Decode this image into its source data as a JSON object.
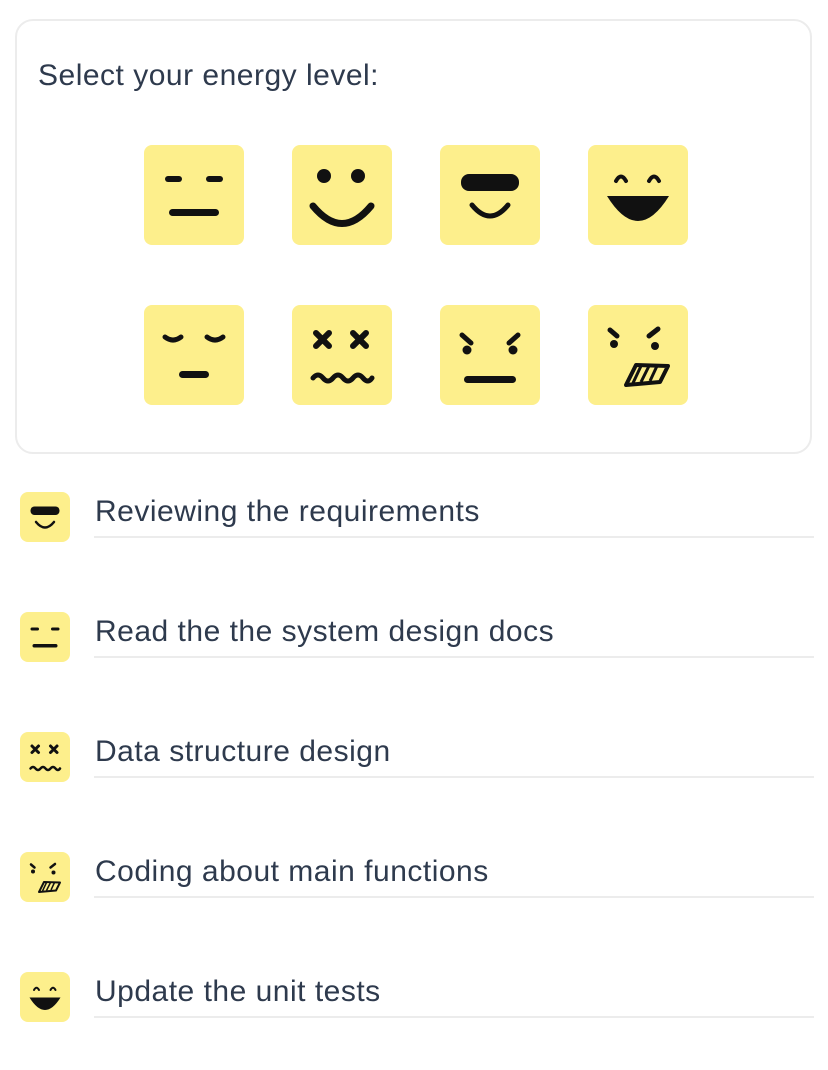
{
  "energy_panel": {
    "title": "Select your energy level:",
    "faces": [
      {
        "icon": "neutral-face-icon"
      },
      {
        "icon": "smiling-face-icon"
      },
      {
        "icon": "sunglasses-face-icon"
      },
      {
        "icon": "grinning-face-icon"
      },
      {
        "icon": "sleepy-face-icon"
      },
      {
        "icon": "dizzy-face-icon"
      },
      {
        "icon": "determined-face-icon"
      },
      {
        "icon": "angry-grimace-face-icon"
      }
    ]
  },
  "tasks": [
    {
      "icon": "sunglasses-face-icon",
      "text": "Reviewing the requirements"
    },
    {
      "icon": "neutral-face-icon",
      "text": "Read the the system design docs"
    },
    {
      "icon": "dizzy-face-icon",
      "text": "Data structure design"
    },
    {
      "icon": "angry-grimace-face-icon",
      "text": "Coding about main functions"
    },
    {
      "icon": "grinning-face-icon",
      "text": "Update the unit tests"
    }
  ],
  "colors": {
    "face_background": "#fdef8c",
    "text": "#2e3a4d",
    "border": "#ececec"
  }
}
